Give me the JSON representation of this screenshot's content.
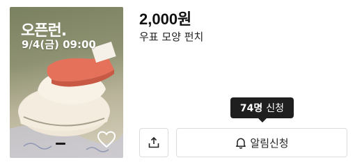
{
  "product": {
    "image": {
      "badge_logo": "오픈런.",
      "badge_date": "9/4(금) 09:00",
      "heart_icon": "heart-outline-icon"
    },
    "price": "2,000원",
    "title": "우표 모양 펀치"
  },
  "tooltip": {
    "count": "74명",
    "suffix": "신청"
  },
  "actions": {
    "share_icon": "share-upload-icon",
    "notify_label": "알림신청",
    "notify_icon": "bell-icon"
  },
  "colors": {
    "accent": "#e5715b",
    "tooltip_bg": "#1f1f1f",
    "border": "#dcdcdc"
  }
}
